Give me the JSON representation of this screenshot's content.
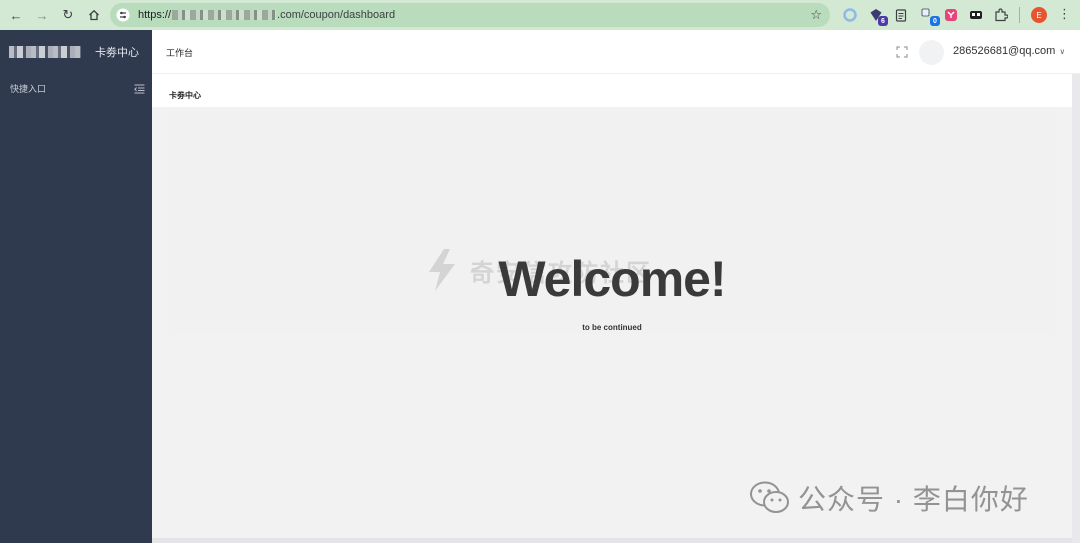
{
  "browser": {
    "url_prefix": "https://",
    "url_suffix": ".com/coupon/dashboard",
    "extensions": [
      {
        "name": "circle-extension-icon",
        "badge": ""
      },
      {
        "name": "shield-extension-icon",
        "badge": "6"
      },
      {
        "name": "notes-extension-icon",
        "badge": ""
      },
      {
        "name": "translate-extension-icon",
        "badge": "0"
      },
      {
        "name": "pink-extension-icon",
        "badge": ""
      },
      {
        "name": "mask-extension-icon",
        "badge": ""
      },
      {
        "name": "puzzle-icon",
        "badge": ""
      }
    ],
    "profile_initial": "E"
  },
  "sidebar": {
    "app_title": "卡劵中心",
    "quick_entry": "快捷入口"
  },
  "header": {
    "tab_label": "工作台",
    "account": "286526681@qq.com"
  },
  "main": {
    "page_title": "卡劵中心",
    "welcome": "Welcome!",
    "subtitle": "to be continued"
  },
  "watermarks": {
    "community": "奇安信攻防社区",
    "wechat": "公众号 · 李白你好"
  }
}
